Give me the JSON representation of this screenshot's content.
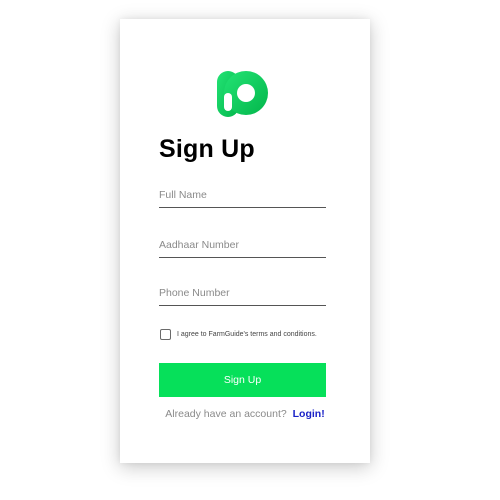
{
  "colors": {
    "accent": "#06e05a",
    "logo_gradient_start": "#20e070",
    "logo_gradient_end": "#02b84a",
    "link": "#1a22c7",
    "underline": "#555555"
  },
  "logo": {
    "icon": "app-logo-icon"
  },
  "page": {
    "title": "Sign Up"
  },
  "form": {
    "full_name_placeholder": "Full Name",
    "aadhaar_placeholder": "Aadhaar Number",
    "phone_placeholder": "Phone Number",
    "terms_label": "I agree to FarmGuide's terms and conditions.",
    "terms_checked": false,
    "submit_label": "Sign Up"
  },
  "footer": {
    "prompt": "Already have an account?",
    "login_label": "Login!"
  }
}
